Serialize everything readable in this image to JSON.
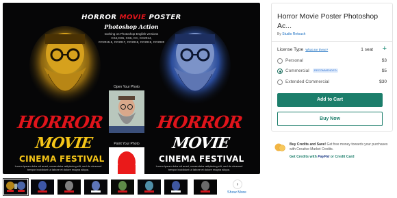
{
  "hero": {
    "poster_title_a": "HORROR",
    "poster_title_b": "MOVIE",
    "poster_title_c": "POSTER",
    "poster_subtitle": "Photoshop Action",
    "poster_compat_1": "working on Photoshop English versions",
    "poster_compat_2": "CS4,CS5, CS6, CC, CC2014,",
    "poster_compat_3": "CC2015.5, CC2017, CC2018, CC2019, CC2020",
    "open_photo_label": "Open Your Photo",
    "paint_photo_label": "Paint Your Photo",
    "horror_word": "HORROR",
    "movie_word": "MOVIE",
    "festival_text": "CINEMA FESTIVAL",
    "lorem_text": "Lorem ipsum dolor sit amet, consectetur adipiscing elit, sed do eiusmod tempor incididunt ut labore et dolore magna aliqua."
  },
  "product": {
    "title": "Horror Movie Poster Photoshop Ac...",
    "by_prefix": "By",
    "author": "Studio Retouch"
  },
  "license": {
    "label": "License Type",
    "help_link": "What are these?",
    "seat_count": "1 seat",
    "options": [
      {
        "label": "Personal",
        "price": "$3",
        "selected": false
      },
      {
        "label": "Commercial",
        "price": "$5",
        "selected": true,
        "badge": "RECOMMENDED"
      },
      {
        "label": "Extended Commercial",
        "price": "$30",
        "selected": false
      }
    ]
  },
  "actions": {
    "add_to_cart": "Add to Cart",
    "buy_now": "Buy Now"
  },
  "credits": {
    "headline": "Buy Credits and Save!",
    "body": "Get free money towards your purchases with Creative Market Credits.",
    "link_prefix": "Get Credits with",
    "paypal": "PayPal",
    "link_suffix": "or Credit Card"
  },
  "gallery": {
    "show_more": "Show More",
    "thumbnail_count": 8
  },
  "colors": {
    "accent": "#1c7e6b",
    "link": "#1a6fc2",
    "poster_red": "#e0141b",
    "poster_yellow": "#f5c518"
  }
}
